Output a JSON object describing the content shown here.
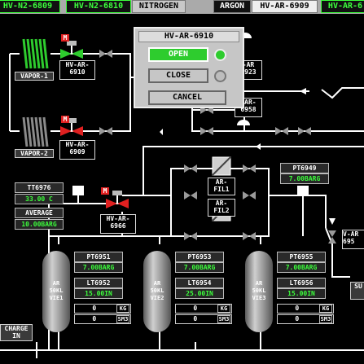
{
  "tabs": [
    {
      "label": "HV-N2-6809",
      "style": "green"
    },
    {
      "label": "HV-N2-6810",
      "style": "green"
    },
    {
      "label": "NITROGEN",
      "style": "grey"
    },
    {
      "label": "ARGON",
      "style": "dark"
    },
    {
      "label": "HV-AR-6909",
      "style": "white"
    },
    {
      "label": "HV-AR-6",
      "style": "green"
    }
  ],
  "vaporizers": [
    {
      "label": "VAPOR-1",
      "color": "#2ecc2e"
    },
    {
      "label": "VAPOR-2",
      "color": "#9a9a9a"
    }
  ],
  "valves": {
    "hv6910": {
      "tag": "HV-AR-\n6910",
      "manual": "M",
      "state_color": "#2ecc2e"
    },
    "hv6909": {
      "tag": "HV-AR-\n6909",
      "manual": "M",
      "state_color": "#e02020"
    },
    "hv6966": {
      "tag": "HV-AR-\n6966",
      "manual": "M",
      "state_color": "#e02020"
    },
    "hv6923": {
      "tag": "-AR\n6923"
    },
    "hv6958": {
      "tag": "-AR-\n6958"
    },
    "hv695x": {
      "tag": "V-AR\n695"
    }
  },
  "popup": {
    "title": "HV-AR-6910",
    "open_label": "OPEN",
    "close_label": "CLOSE",
    "cancel_label": "CANCEL",
    "open_indicator": "#2ecc2e",
    "close_indicator": "#bdbdbd"
  },
  "instruments": {
    "tt6976": {
      "tag": "TT6976",
      "value": "33.00 C"
    },
    "average": {
      "tag": "AVERAGE",
      "value": "10.00BARG"
    },
    "pt6949": {
      "tag": "PT6949",
      "value": "7.00BARG"
    }
  },
  "filters": [
    {
      "label": "AR-\nFIL1"
    },
    {
      "label": "AR-\nFIL2"
    }
  ],
  "vessels": [
    {
      "label": "AR\n50KL\nVIE1",
      "pt": {
        "tag": "PT6951",
        "value": "7.00BARG"
      },
      "lt": {
        "tag": "LT6952",
        "value": "15.00IN"
      },
      "kg": {
        "value": "0",
        "unit": "KG"
      },
      "sm3": {
        "value": "0",
        "unit": "SM3"
      }
    },
    {
      "label": "AR\n50KL\nVIE2",
      "pt": {
        "tag": "PT6953",
        "value": "7.00BARG"
      },
      "lt": {
        "tag": "LT6954",
        "value": "25.00IN"
      },
      "kg": {
        "value": "0",
        "unit": "KG"
      },
      "sm3": {
        "value": "0",
        "unit": "SM3"
      }
    },
    {
      "label": "AR\n50KL\nVIE3",
      "pt": {
        "tag": "PT6955",
        "value": "7.00BARG"
      },
      "lt": {
        "tag": "LT6956",
        "value": "15.00IN"
      },
      "kg": {
        "value": "0",
        "unit": "KG"
      },
      "sm3": {
        "value": "0",
        "unit": "SM3"
      }
    }
  ],
  "charge_in": "CHARGE\nIN",
  "supply_label": "SU"
}
